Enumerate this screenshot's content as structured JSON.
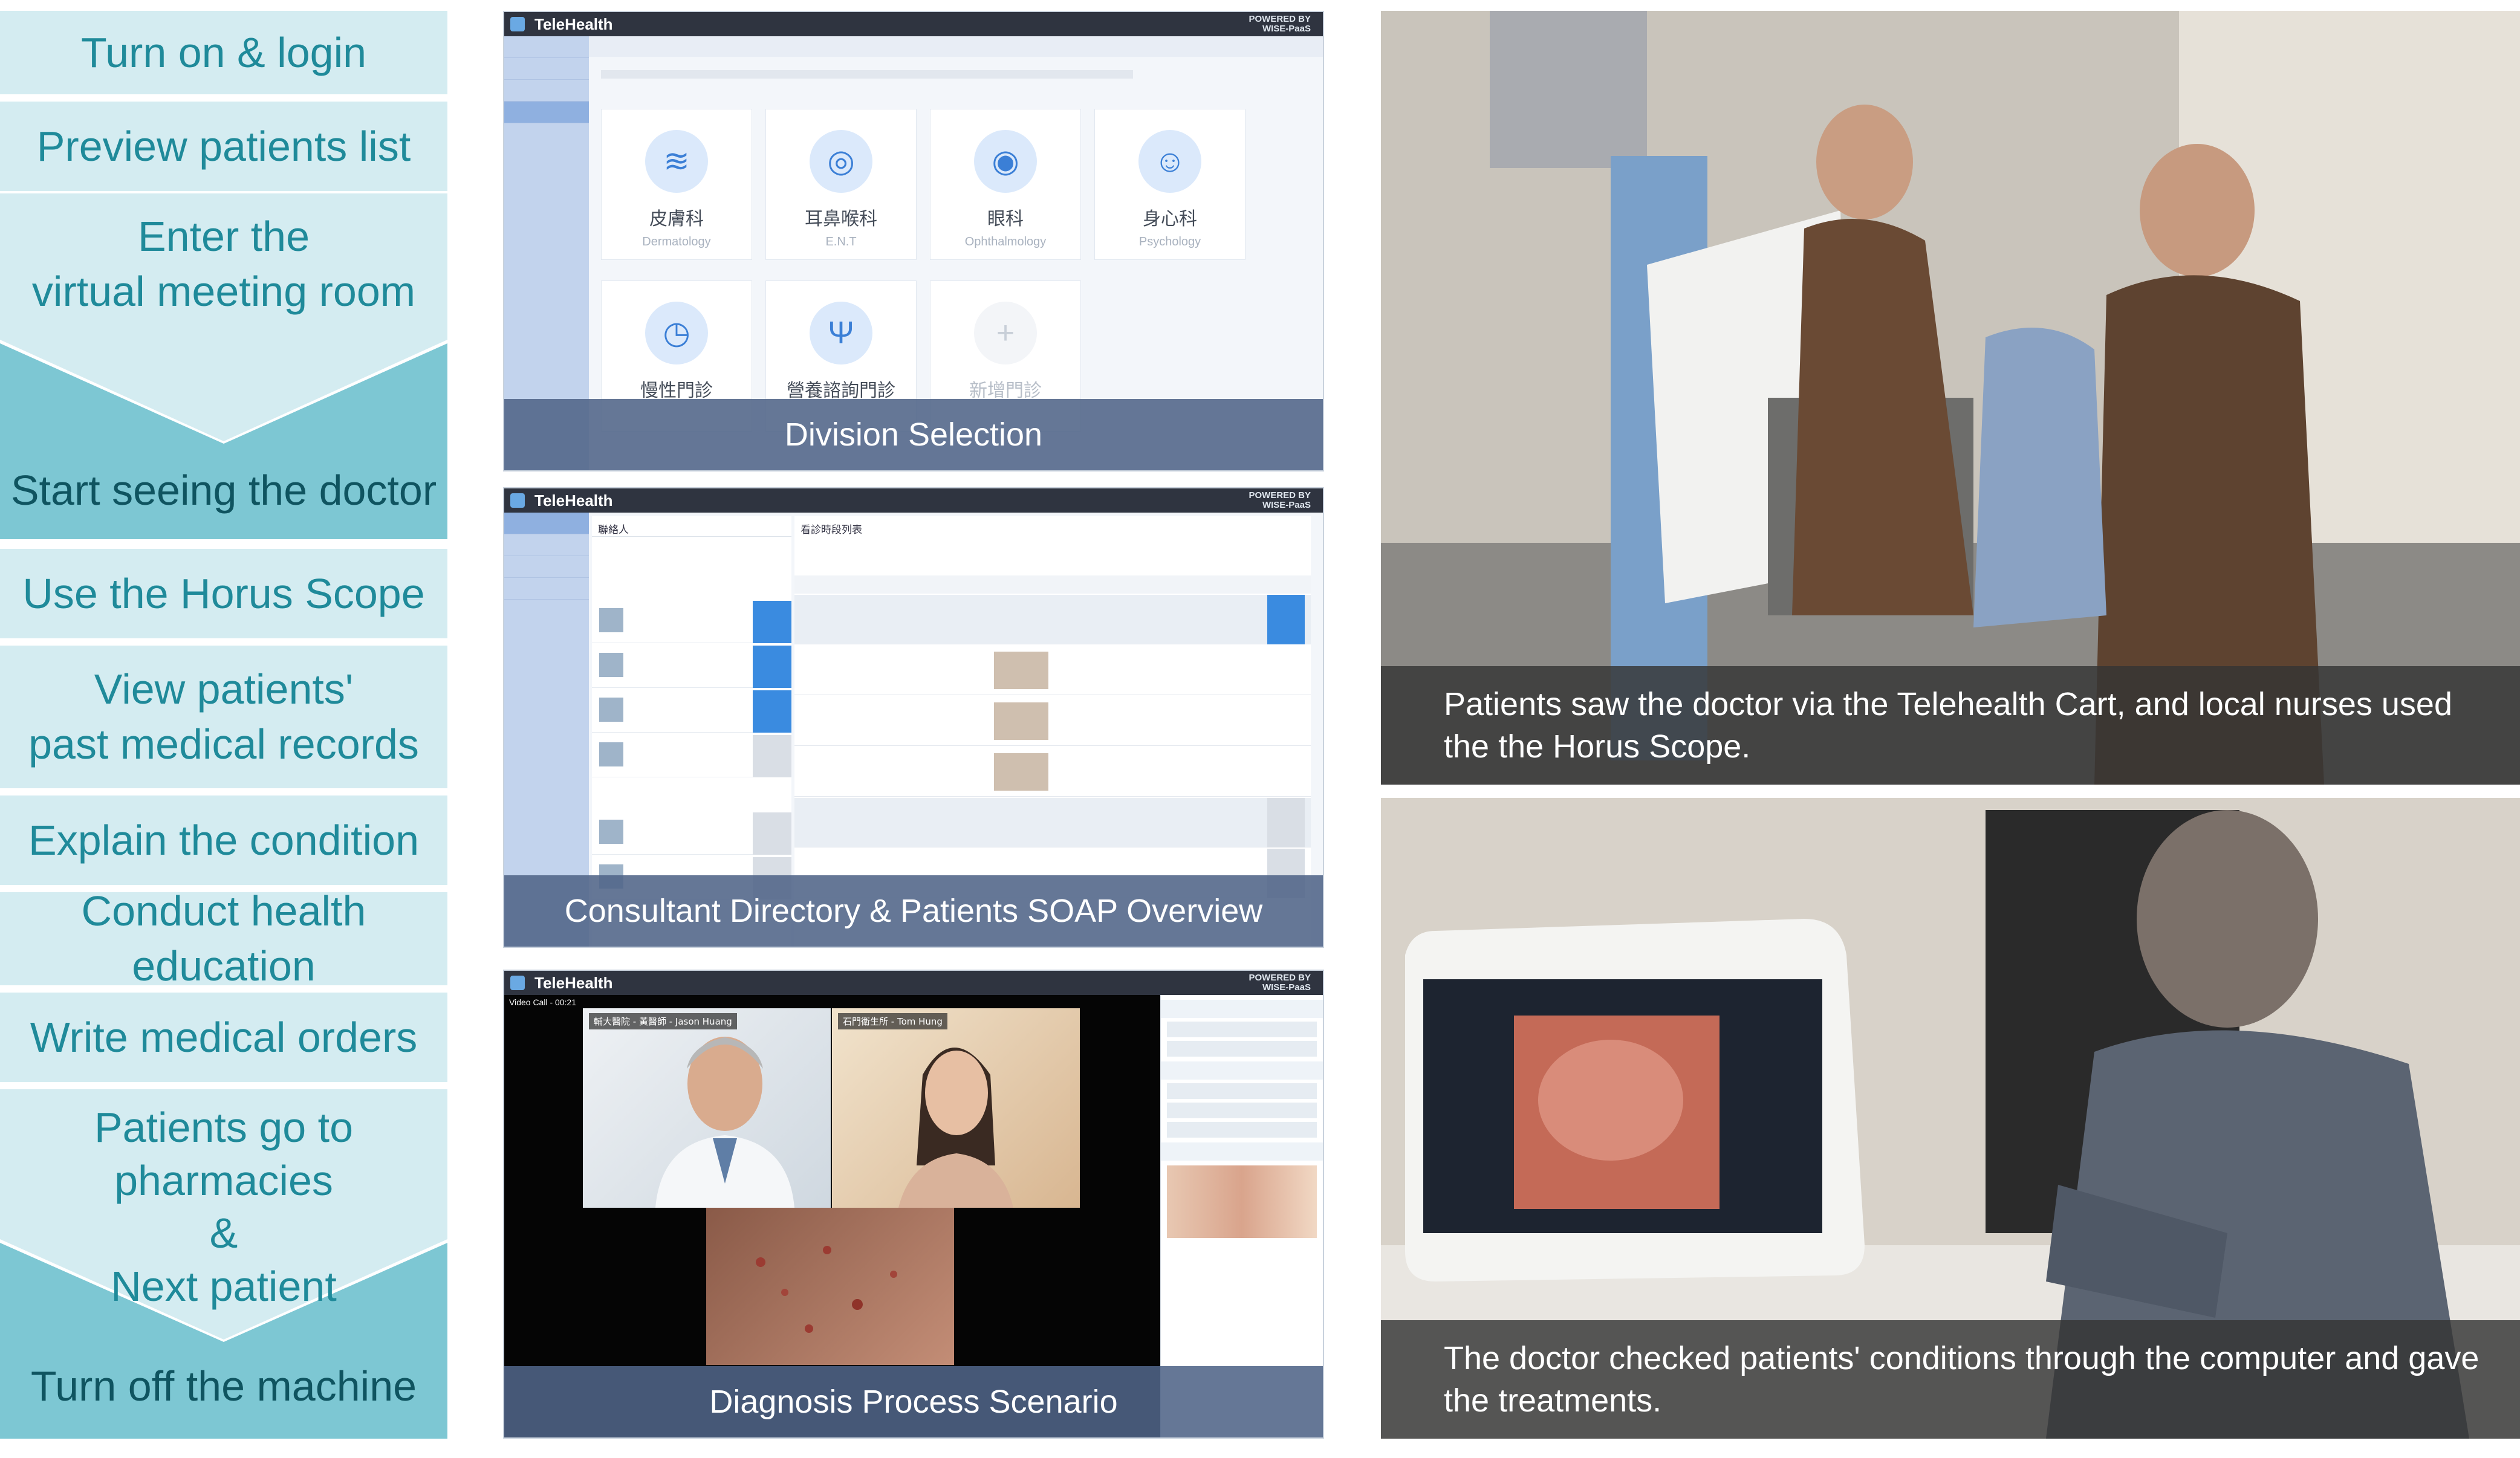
{
  "steps": [
    "Turn on & login",
    "Preview patients list",
    "Enter the\nvirtual meeting room",
    "Start seeing the doctor",
    "Use the Horus Scope",
    "View patients'\npast medical records",
    "Explain the condition",
    "Conduct health education",
    "Write medical orders",
    "Patients go to pharmacies\n&\nNext patient",
    "Turn off the machine"
  ],
  "panels": {
    "app_name": "TeleHealth",
    "powered_by": "POWERED BY",
    "platform": "WISE-PaaS",
    "division": {
      "caption": "Division Selection",
      "cards": [
        {
          "name": "皮膚科",
          "en": "Dermatology",
          "icon": "skin-icon"
        },
        {
          "name": "耳鼻喉科",
          "en": "E.N.T",
          "icon": "ear-icon"
        },
        {
          "name": "眼科",
          "en": "Ophthalmology",
          "icon": "eye-icon"
        },
        {
          "name": "身心科",
          "en": "Psychology",
          "icon": "head-icon"
        },
        {
          "name": "慢性門診",
          "en": "",
          "icon": "clock-icon"
        },
        {
          "name": "營養諮詢門診",
          "en": "",
          "icon": "cutlery-icon"
        },
        {
          "name": "新增門診",
          "en": "",
          "icon": "plus-icon"
        }
      ]
    },
    "directory": {
      "caption": "Consultant Directory & Patients SOAP Overview",
      "list_title": "聯絡人",
      "soap_title": "看診時段列表"
    },
    "diagnosis": {
      "caption": "Diagnosis Process Scenario",
      "call_label": "Video Call - 00:21",
      "doctor_tag": "輔大醫院 - 黃醫師 - Jason Huang",
      "patient_tag": "石門衛生所 - Tom Hung"
    }
  },
  "photos": [
    {
      "caption": "Patients saw the doctor via the Telehealth Cart, and local nurses used the the Horus Scope."
    },
    {
      "caption": "The doctor checked patients' conditions through the computer and gave the treatments."
    }
  ],
  "colors": {
    "step_light": "#d4ecf1",
    "step_dark": "#7dc7d3",
    "step_text": "#1f8a9a",
    "caption_bar": "#50648a",
    "call_blue": "#3a8be0"
  }
}
